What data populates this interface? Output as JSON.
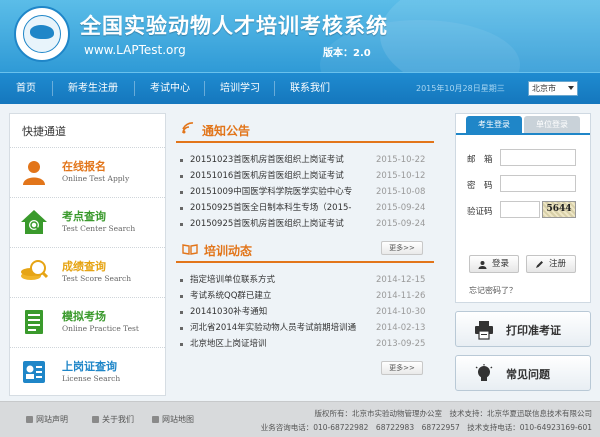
{
  "header": {
    "title": "全国实验动物人才培训考核系统",
    "url": "www.LAPTest.org",
    "version": "版本：2.0"
  },
  "nav": {
    "items": [
      "首页",
      "新考生注册",
      "考试中心",
      "培训学习",
      "联系我们"
    ],
    "date": "2015年10月28日星期三",
    "city": "北京市"
  },
  "quick_access": {
    "title": "快捷通道",
    "items": [
      {
        "cn": "在线报名",
        "en": "Online Test Apply",
        "color": "#e2751a",
        "icon": "user-icon"
      },
      {
        "cn": "考点查询",
        "en": "Test Center Search",
        "color": "#3a9a2c",
        "icon": "house-search-icon"
      },
      {
        "cn": "成绩查询",
        "en": "Test Score Search",
        "color": "#e6a414",
        "icon": "score-search-icon"
      },
      {
        "cn": "模拟考场",
        "en": "Online Practice Test",
        "color": "#3a9a2c",
        "icon": "document-icon"
      },
      {
        "cn": "上岗证查询",
        "en": "License Search",
        "color": "#1f86c8",
        "icon": "license-card-icon"
      }
    ]
  },
  "notice": {
    "title": "通知公告",
    "items": [
      {
        "text": "20151023首医机房首医组织上岗证考试",
        "date": "2015-10-22"
      },
      {
        "text": "20151016首医机房首医组织上岗证考试",
        "date": "2015-10-12"
      },
      {
        "text": "20151009中国医学科学院医学实验中心专",
        "date": "2015-10-08"
      },
      {
        "text": "20150925首医全日制本科生专场（2015-",
        "date": "2015-09-24"
      },
      {
        "text": "20150925首医机房首医组织上岗证考试",
        "date": "2015-09-24"
      }
    ],
    "more": "更多>>"
  },
  "training": {
    "title": "培训动态",
    "items": [
      {
        "text": "指定培训单位联系方式",
        "date": "2014-12-15"
      },
      {
        "text": "考试系统QQ群已建立",
        "date": "2014-11-26"
      },
      {
        "text": "20141030补考通知",
        "date": "2014-10-30"
      },
      {
        "text": "河北省2014年实验动物人员考试前期培训通",
        "date": "2014-02-13"
      },
      {
        "text": "北京地区上岗证培训",
        "date": "2013-09-25"
      }
    ],
    "more": "更多>>"
  },
  "login": {
    "tab_student": "考生登录",
    "tab_unit": "单位登录",
    "email_label": "邮　箱",
    "password_label": "密　码",
    "captcha_label": "验证码",
    "captcha_text": "5644",
    "login_button": "登录",
    "register_button": "注册",
    "forgot": "忘记密码了？"
  },
  "actions": {
    "print_ticket": "打印准考证",
    "faq": "常见问题"
  },
  "footer": {
    "links": [
      "网站声明",
      "关于我们",
      "网站地图"
    ],
    "line1": "版权所有：北京市实验动物管理办公室　技术支持：北京华夏迅联信息技术有限公司",
    "line2": "业务咨询电话：010-68722982　68722983　68722957　技术支持电话：010-64923169-601"
  }
}
